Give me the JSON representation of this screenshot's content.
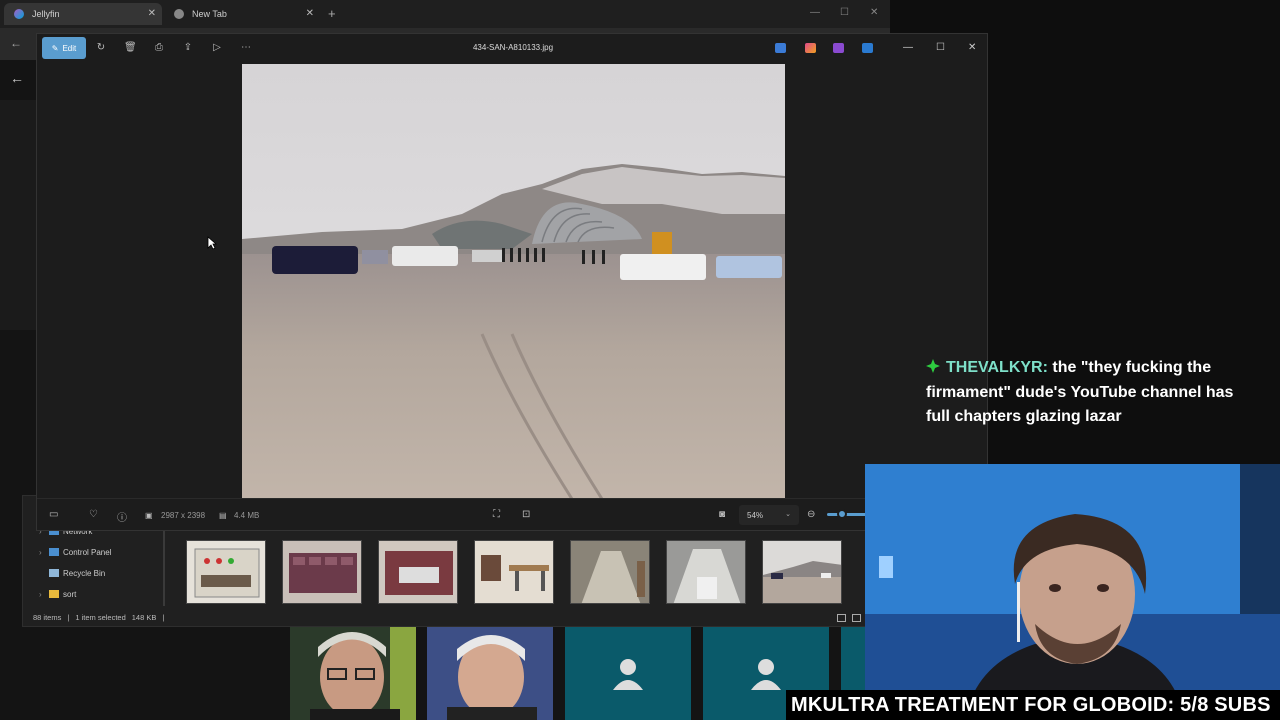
{
  "browser": {
    "tabs": [
      {
        "label": "Jellyfin",
        "active": true
      },
      {
        "label": "New Tab",
        "active": false
      }
    ],
    "new_tab_glyph": "+"
  },
  "explorer": {
    "tree": [
      {
        "label": "Network",
        "icon": "network-icon"
      },
      {
        "label": "Control Panel",
        "icon": "control-panel-icon"
      },
      {
        "label": "Recycle Bin",
        "icon": "recycle-bin-icon"
      },
      {
        "label": "sort",
        "icon": "folder-icon"
      }
    ],
    "status": {
      "items": "88 items",
      "selected": "1 item selected",
      "size": "148 KB"
    }
  },
  "photos": {
    "edit_label": "Edit",
    "filename": "434-SAN-A810133.jpg",
    "dimensions": "2987 x 2398",
    "filesize": "4.4 MB",
    "zoom": "54%",
    "accent": "#5a9dcf"
  },
  "chat": {
    "username": "THEVALKYR:",
    "message": "the \"they fucking the firmament\" dude's YouTube channel has full chapters glazing lazar",
    "username_color": "#7ee0c9"
  },
  "banner": {
    "text": "MKULTRA TREATMENT FOR GLOBOID: 5/8 SUBS"
  }
}
